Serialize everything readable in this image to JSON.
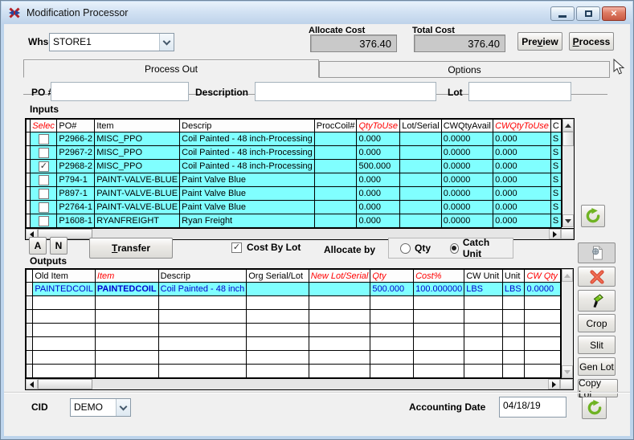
{
  "window": {
    "title": "Modification Processor"
  },
  "header": {
    "whse_label": "Whse",
    "whse_value": "STORE1",
    "allocate_cost_label": "Allocate Cost",
    "allocate_cost_value": "376.40",
    "total_cost_label": "Total Cost",
    "total_cost_value": "376.40",
    "preview_button": {
      "pre": "Pre",
      "accel": "v",
      "post": "iew"
    },
    "process_button": {
      "pre": "",
      "accel": "P",
      "post": "rocess"
    }
  },
  "tabs": {
    "process_out": "Process Out",
    "options": "Options"
  },
  "po_row": {
    "po_label": "PO #",
    "po_value": "",
    "description_label": "Description",
    "description_value": "",
    "lot_label": "Lot",
    "lot_value": ""
  },
  "inputs": {
    "section_label": "Inputs",
    "columns": [
      {
        "label": "Selec",
        "hot": true
      },
      {
        "label": "PO#"
      },
      {
        "label": "Item"
      },
      {
        "label": "Descrip"
      },
      {
        "label": "ProcCoil#"
      },
      {
        "label": "QtyToUse",
        "hot": true
      },
      {
        "label": "Lot/Serial"
      },
      {
        "label": "CWQtyAvail"
      },
      {
        "label": "CWQtyToUse",
        "hot": true
      },
      {
        "label": "C",
        "clipped": true
      }
    ],
    "rows": [
      {
        "checked": false,
        "cells": [
          "P2966-2",
          "MISC_PPO",
          "Coil Painted - 48 inch-Processing",
          "",
          "0.000",
          "",
          "0.0000",
          "0.000",
          "S"
        ]
      },
      {
        "checked": false,
        "cells": [
          "P2967-2",
          "MISC_PPO",
          "Coil Painted - 48 inch-Processing",
          "",
          "0.000",
          "",
          "0.0000",
          "0.000",
          "S"
        ]
      },
      {
        "checked": true,
        "cells": [
          "P2968-2",
          "MISC_PPO",
          "Coil Painted - 48 inch-Processing",
          "",
          "500.000",
          "",
          "0.0000",
          "0.000",
          "S"
        ]
      },
      {
        "checked": false,
        "cells": [
          "P794-1",
          "PAINT-VALVE-BLUE",
          "Paint Valve Blue",
          "",
          "0.000",
          "",
          "0.0000",
          "0.000",
          "S"
        ]
      },
      {
        "checked": false,
        "cells": [
          "P897-1",
          "PAINT-VALVE-BLUE",
          "Paint Valve Blue",
          "",
          "0.000",
          "",
          "0.0000",
          "0.000",
          "S"
        ]
      },
      {
        "checked": false,
        "cells": [
          "P2764-1",
          "PAINT-VALVE-BLUE",
          "Paint Valve Blue",
          "",
          "0.000",
          "",
          "0.0000",
          "0.000",
          "S"
        ]
      },
      {
        "checked": false,
        "cells": [
          "P1608-1",
          "RYANFREIGHT",
          "Ryan Freight",
          "",
          "0.000",
          "",
          "0.0000",
          "0.000",
          "S"
        ]
      }
    ]
  },
  "middle": {
    "a_button": "A",
    "n_button": "N",
    "transfer_button": {
      "pre": "",
      "accel": "T",
      "post": "ransfer"
    },
    "cost_by_lot_label": "Cost By Lot",
    "cost_by_lot_checked": true,
    "allocate_by_label": "Allocate by",
    "radio_qty": "Qty",
    "radio_catch_unit": "Catch Unit",
    "allocate_by_selected": "Catch Unit"
  },
  "outputs": {
    "section_label": "Outputs",
    "columns": [
      {
        "label": "Old Item"
      },
      {
        "label": "Item",
        "hot": true
      },
      {
        "label": "Descrip"
      },
      {
        "label": "Org Serial/Lot"
      },
      {
        "label": "New Lot/Serial",
        "hot": true
      },
      {
        "label": "Qty",
        "hot": true
      },
      {
        "label": "Cost%",
        "hot": true
      },
      {
        "label": "CW Unit"
      },
      {
        "label": "Unit"
      },
      {
        "label": "CW Qty",
        "hot": true
      }
    ],
    "rows": [
      {
        "cells": [
          "PAINTEDCOIL",
          "PAINTEDCOIL",
          "Coil Painted - 48 inch",
          "",
          "",
          "500.000",
          "100.000000",
          "LBS",
          "LBS",
          "0.0000"
        ]
      }
    ],
    "empty_row_count": 6
  },
  "side_buttons": {
    "crop": "Crop",
    "slit": "Slit",
    "gen_lot": "Gen Lot",
    "copy_lot": "Copy Lot"
  },
  "footer": {
    "cid_label": "CID",
    "cid_value": "DEMO",
    "accounting_date_label": "Accounting Date",
    "accounting_date_value": "04/18/19"
  },
  "colors": {
    "row_highlight": "#80ffff",
    "hot_column_red": "#ff0000",
    "value_blue": "#0000cc",
    "titlebar_blue": "#cfe1f3"
  }
}
